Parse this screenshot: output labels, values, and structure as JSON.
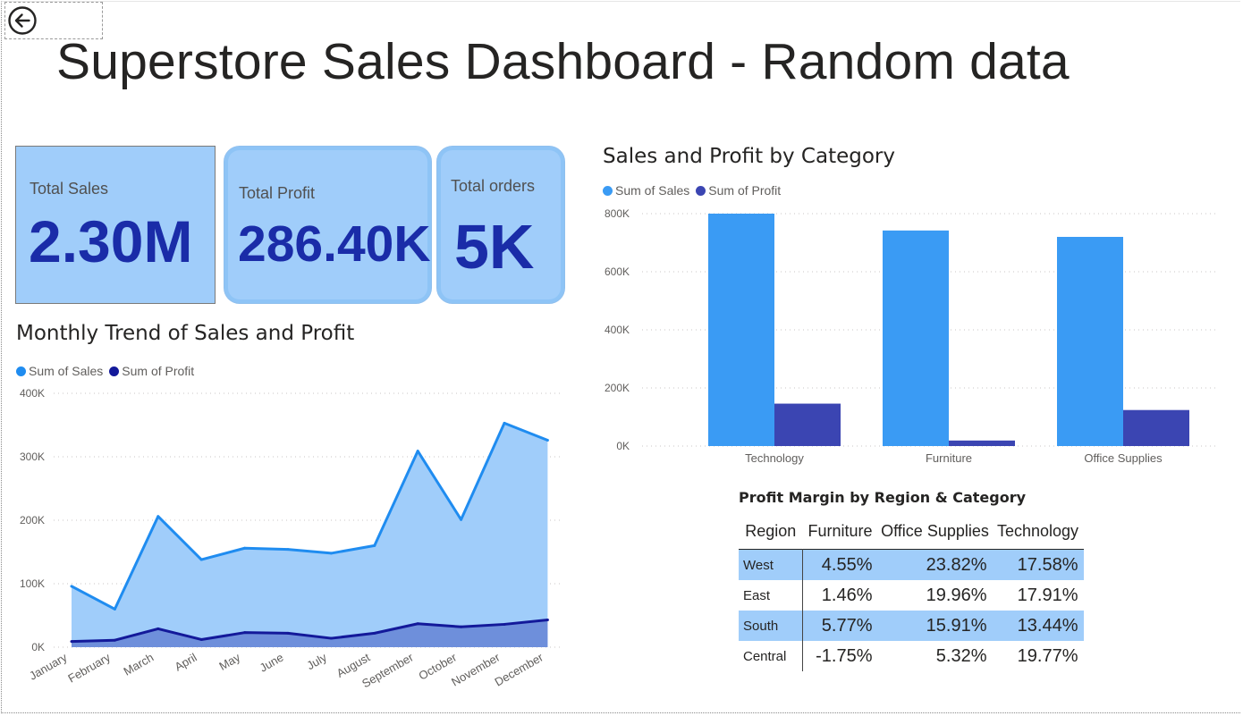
{
  "title": "Superstore Sales Dashboard - Random data",
  "colors": {
    "sales": "#3a9bf4",
    "profit": "#3b45b2",
    "line_sales": "#1f8cf0",
    "line_profit": "#13199a",
    "area_sales": "#a0cdfa",
    "area_profit": "#6e8fdb",
    "card": "#a0cdfa",
    "kpi": "#1a2ca8"
  },
  "icons": {
    "back": "back-arrow-icon"
  },
  "kpis": [
    {
      "label": "Total Sales",
      "value": "2.30M"
    },
    {
      "label": "Total Profit",
      "value": "286.40K"
    },
    {
      "label": "Total orders",
      "value": "5K"
    }
  ],
  "chart_data": [
    {
      "type": "area",
      "title": "Monthly Trend of Sales and Profit",
      "legend": [
        "Sum of Sales",
        "Sum of Profit"
      ],
      "legend_position": "top-left",
      "categories": [
        "January",
        "February",
        "March",
        "April",
        "May",
        "June",
        "July",
        "August",
        "September",
        "October",
        "November",
        "December"
      ],
      "series": [
        {
          "name": "Sum of Sales",
          "values": [
            96000,
            60000,
            206000,
            138000,
            156000,
            154000,
            148000,
            160000,
            309000,
            201000,
            353000,
            326000
          ]
        },
        {
          "name": "Sum of Profit",
          "values": [
            9000,
            11000,
            29000,
            12000,
            23000,
            22000,
            14000,
            22000,
            37000,
            32000,
            36000,
            43000
          ]
        }
      ],
      "ylim": [
        0,
        400000
      ],
      "yticks": [
        "0K",
        "100K",
        "200K",
        "300K",
        "400K"
      ],
      "grid": true
    },
    {
      "type": "bar",
      "title": "Sales and Profit by Category",
      "legend": [
        "Sum of Sales",
        "Sum of Profit"
      ],
      "legend_position": "top-left",
      "categories": [
        "Technology",
        "Furniture",
        "Office Supplies"
      ],
      "series": [
        {
          "name": "Sum of Sales",
          "values": [
            800000,
            742000,
            720000
          ]
        },
        {
          "name": "Sum of Profit",
          "values": [
            146000,
            19000,
            124000
          ]
        }
      ],
      "ylim": [
        0,
        800000
      ],
      "yticks": [
        "0K",
        "200K",
        "400K",
        "600K",
        "800K"
      ],
      "grid": true
    },
    {
      "type": "table",
      "title": "Profit Margin by Region & Category",
      "columns": [
        "Region",
        "Furniture",
        "Office Supplies",
        "Technology"
      ],
      "rows": [
        [
          "West",
          "4.55%",
          "23.82%",
          "17.58%"
        ],
        [
          "East",
          "1.46%",
          "19.96%",
          "17.91%"
        ],
        [
          "South",
          "5.77%",
          "15.91%",
          "13.44%"
        ],
        [
          "Central",
          "-1.75%",
          "5.32%",
          "19.77%"
        ]
      ]
    }
  ]
}
